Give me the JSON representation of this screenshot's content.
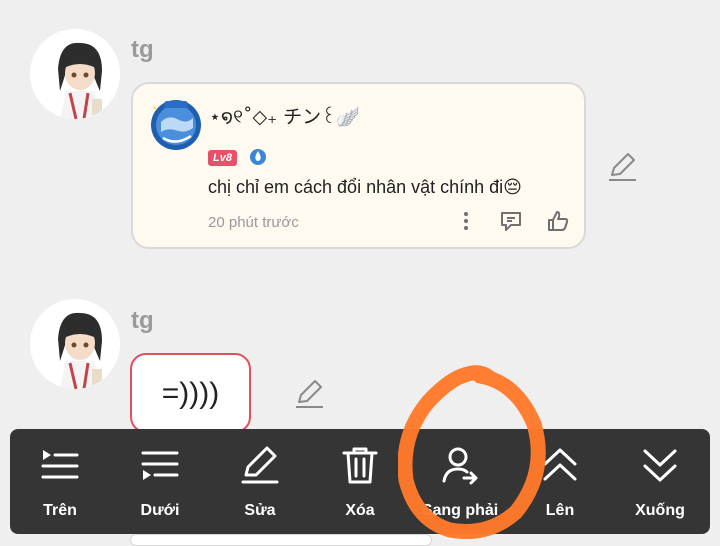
{
  "colors": {
    "background": "#efefef",
    "quote_card_bg": "#fffaf0",
    "level_badge": "#e8506a",
    "bubble_border": "#e05060",
    "action_bar": "#353535",
    "annotation_ring": "#ff7a2a"
  },
  "messages": [
    {
      "username": "tg",
      "avatar_icon": "anime-avatar",
      "quote": {
        "badge_icon": "globe-badge",
        "name": "⋆໑୧˚◇₊ チン꒰🪽",
        "level": "Lv8",
        "level_icon": "droplet-icon",
        "text": "chị chỉ em cách đổi nhân vật chính  đi😔",
        "time": "20 phút trước",
        "actions": [
          "more-vertical-icon",
          "reply-icon",
          "thumbs-up-icon"
        ]
      },
      "edit_icon": "pencil-icon"
    },
    {
      "username": "tg",
      "avatar_icon": "anime-avatar",
      "text": "=))))",
      "edit_icon": "pencil-icon"
    }
  ],
  "action_bar": {
    "items": [
      {
        "label": "Trên",
        "icon": "move-top-icon"
      },
      {
        "label": "Dưới",
        "icon": "move-bottom-icon"
      },
      {
        "label": "Sửa",
        "icon": "pencil-icon"
      },
      {
        "label": "Xóa",
        "icon": "trash-icon"
      },
      {
        "label": "Sang phải",
        "icon": "user-arrow-icon"
      },
      {
        "label": "Lên",
        "icon": "chevrons-up-icon"
      },
      {
        "label": "Xuống",
        "icon": "chevrons-down-icon"
      }
    ]
  },
  "annotation": {
    "shape": "hand-drawn-circle",
    "target": "Sang phải"
  }
}
